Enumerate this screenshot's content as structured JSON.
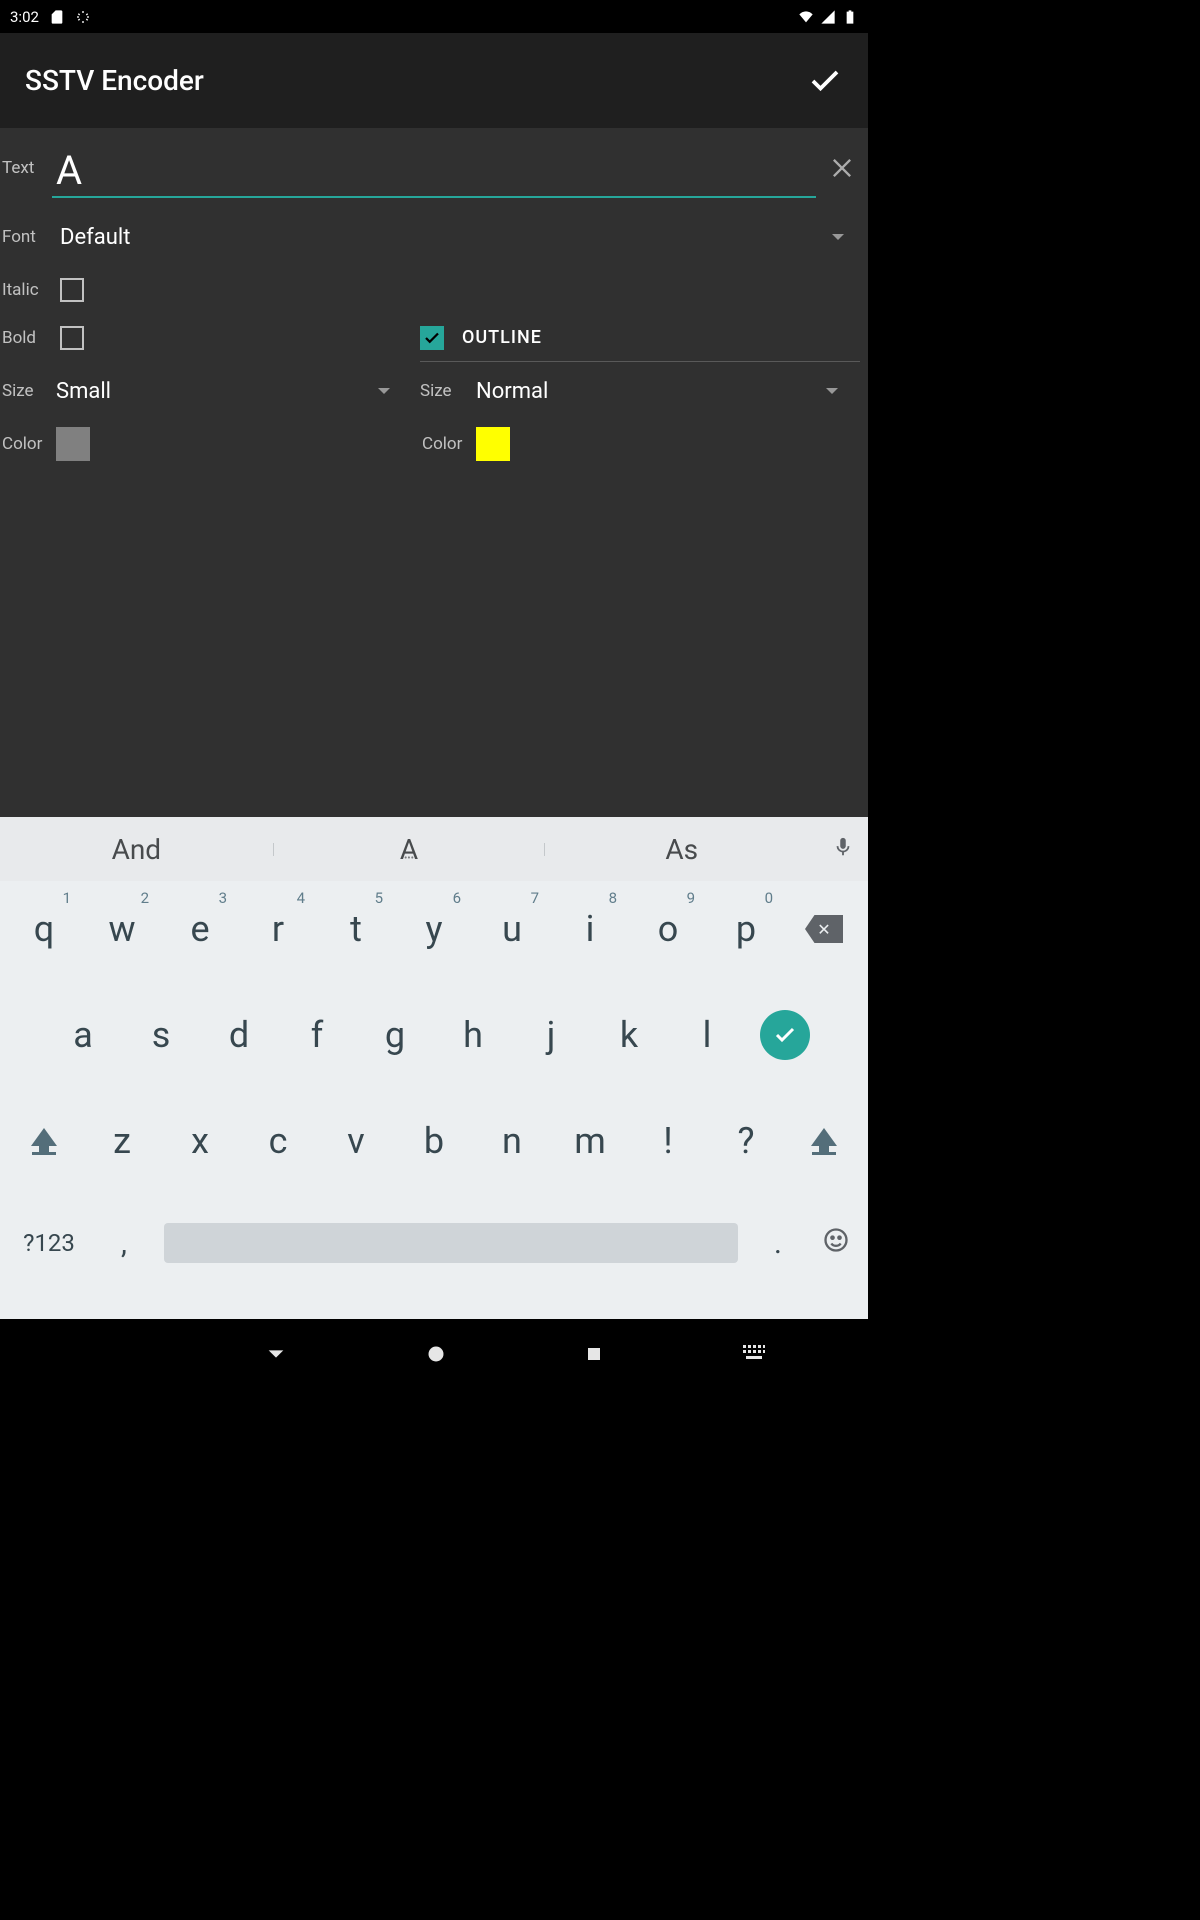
{
  "status": {
    "time": "3:02"
  },
  "appbar": {
    "title": "SSTV Encoder"
  },
  "form": {
    "text_label": "Text",
    "text_value": "A",
    "font_label": "Font",
    "font_value": "Default",
    "italic_label": "Italic",
    "italic_checked": false,
    "bold_label": "Bold",
    "bold_checked": false,
    "size_label": "Size",
    "size_value": "Small",
    "color_label": "Color",
    "color_value": "#808080",
    "outline": {
      "label": "OUTLINE",
      "checked": true,
      "size_label": "Size",
      "size_value": "Normal",
      "color_label": "Color",
      "color_value": "#ffff00"
    }
  },
  "keyboard": {
    "suggestions": [
      "And",
      "A",
      "As"
    ],
    "row1": [
      {
        "k": "q",
        "n": "1"
      },
      {
        "k": "w",
        "n": "2"
      },
      {
        "k": "e",
        "n": "3"
      },
      {
        "k": "r",
        "n": "4"
      },
      {
        "k": "t",
        "n": "5"
      },
      {
        "k": "y",
        "n": "6"
      },
      {
        "k": "u",
        "n": "7"
      },
      {
        "k": "i",
        "n": "8"
      },
      {
        "k": "o",
        "n": "9"
      },
      {
        "k": "p",
        "n": "0"
      }
    ],
    "row2": [
      "a",
      "s",
      "d",
      "f",
      "g",
      "h",
      "j",
      "k",
      "l"
    ],
    "row3": [
      "z",
      "x",
      "c",
      "v",
      "b",
      "n",
      "m",
      "!",
      "?"
    ],
    "sym": "?123",
    "comma": ",",
    "dot": "."
  }
}
